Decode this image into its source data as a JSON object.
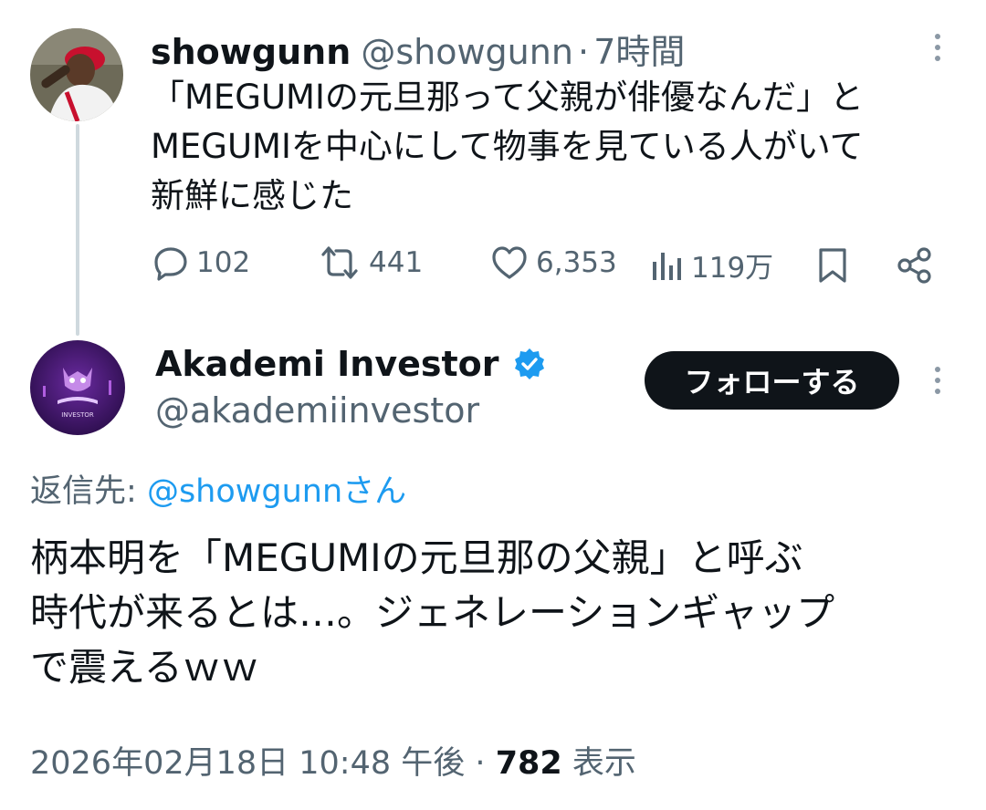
{
  "tweet1": {
    "name": "showgunn",
    "handle": "@showgunn",
    "separator": "·",
    "time": "7時間",
    "text_lines": [
      "「MEGUMIの元旦那って父親が俳優なんだ」と",
      "MEGUMIを中心にして物事を見ている人がいて",
      "新鮮に感じた"
    ],
    "actions": {
      "replies": "102",
      "reposts": "441",
      "likes": "6,353",
      "views": "119万"
    }
  },
  "tweet2": {
    "name": "Akademi Investor",
    "handle": "@akademiinvestor",
    "follow_label": "フォローする",
    "avatar_text": "INVESTOR",
    "reply_to_label": "返信先:",
    "reply_to_handle": "@showgunnさん",
    "text_lines": [
      "柄本明を「MEGUMIの元旦那の父親」と呼ぶ",
      "時代が来るとは…。ジェネレーションギャップ",
      "で震えるｗｗ"
    ],
    "timestamp": "2026年02月18日 10:48 午後",
    "separator": "·",
    "views_count": "782",
    "views_label": "表示"
  },
  "colors": {
    "text": "#0f1419",
    "secondary": "#536471",
    "link": "#1d9bf0",
    "verified": "#1d9bf0"
  }
}
